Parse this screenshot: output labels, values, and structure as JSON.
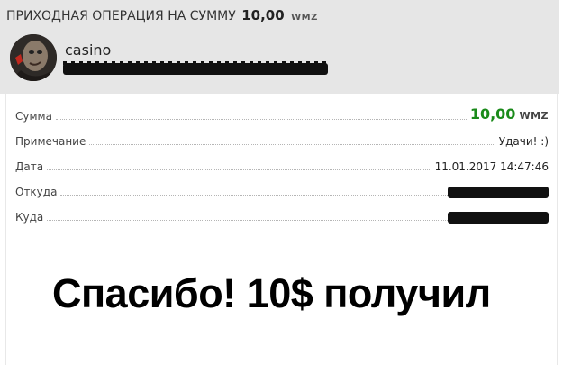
{
  "header": {
    "title": "ПРИХОДНАЯ ОПЕРАЦИЯ НА СУММУ",
    "amount": "10,00",
    "currency": "WMZ"
  },
  "sender": {
    "name": "casino"
  },
  "details": {
    "sum_label": "Сумма",
    "sum_value": "10,00",
    "sum_currency": "WMZ",
    "note_label": "Примечание",
    "note_value": "Удачи! :)",
    "date_label": "Дата",
    "date_value": "11.01.2017 14:47:46",
    "from_label": "Откуда",
    "to_label": "Куда"
  },
  "caption": "Спасибо! 10$ получил",
  "colors": {
    "header_bg": "#e6e6e6",
    "amount_green": "#1a8a1a"
  }
}
